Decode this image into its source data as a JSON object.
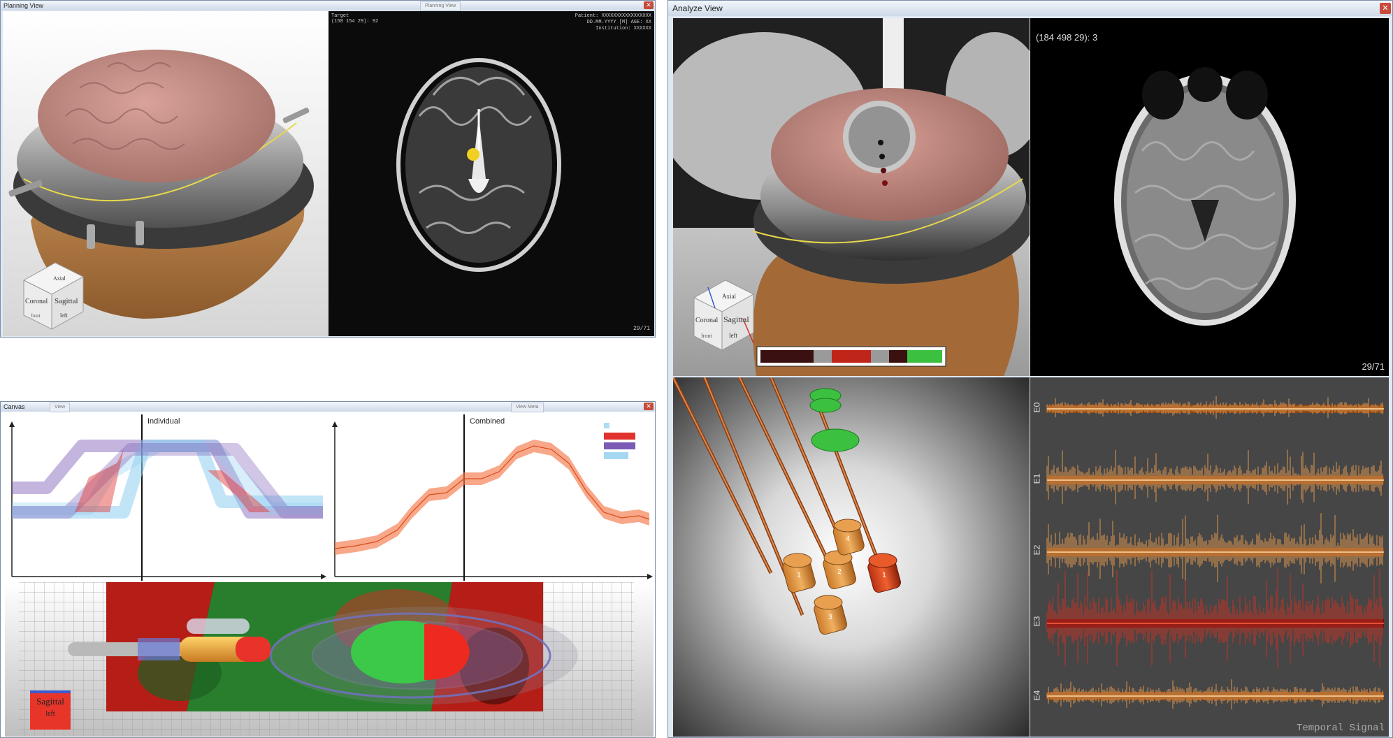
{
  "planning": {
    "title": "Planning View",
    "tab": "Planning View",
    "target_label": "Target",
    "target_value": "(158 154 29): 92",
    "patient": "Patient: XXXXXXXXXXXXXXXXX",
    "dob": "DD.MM.YYYY [M] AGE: XX",
    "institution": "Institution: XXXXXX",
    "slice": "29/71",
    "cube": {
      "axial": "Axial",
      "coronal": "Coronal",
      "sagittal": "Sagittal",
      "left": "left",
      "front": "front"
    }
  },
  "canvas": {
    "title": "Canvas",
    "tab1": "View",
    "tab2": "View Meta",
    "individual_label": "Individual",
    "combined_label": "Combined",
    "sagittal_label": "Sagittal",
    "left_label": "left"
  },
  "analyze": {
    "title": "Analyze View",
    "coord": "(184 498 29): 3",
    "slice": "29/71",
    "signal_title": "Temporal Signal",
    "channels": [
      "E0",
      "E1",
      "E2",
      "E3",
      "E4"
    ],
    "cube": {
      "axial": "Axial",
      "coronal": "Coronal",
      "sagittal": "Sagittal",
      "left": "left",
      "front": "front"
    },
    "electrode_labels": [
      "1",
      "2",
      "3",
      "4",
      "1"
    ]
  },
  "colors": {
    "purple": "#7b5bb5",
    "red": "#e0332e",
    "lightblue": "#8fcdf0",
    "orange": "#f47a4a",
    "signal_orange": "#f0a050",
    "signal_red": "#d23020"
  }
}
